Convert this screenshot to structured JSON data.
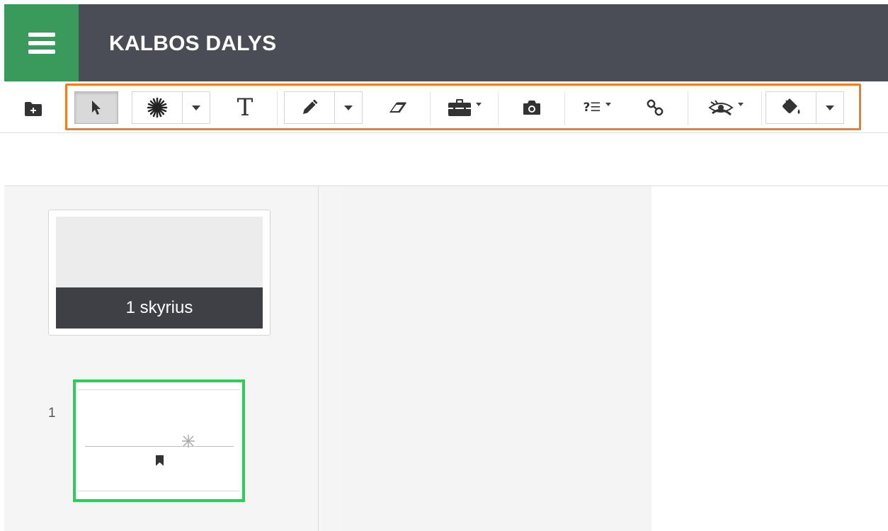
{
  "header": {
    "title": "KALBOS DALYS",
    "menu_icon": "hamburger-icon",
    "accent_color": "#3a9a5c",
    "bar_color": "#4a4d55"
  },
  "toolbar": {
    "folder_icon": "folder-add-icon",
    "highlight_color": "#f07c23",
    "tools": [
      {
        "name": "select",
        "icon": "cursor-arrow-icon",
        "active": true
      },
      {
        "name": "effects",
        "icon": "starburst-icon",
        "dropdown": true
      },
      {
        "name": "text",
        "icon": "text-icon",
        "glyph": "T"
      },
      {
        "name": "pen",
        "icon": "pencil-icon",
        "dropdown": true
      },
      {
        "name": "eraser",
        "icon": "eraser-icon"
      },
      {
        "name": "toolbox",
        "icon": "toolbox-icon",
        "dropdown": true
      },
      {
        "name": "camera",
        "icon": "camera-icon"
      },
      {
        "name": "quiz",
        "icon": "question-list-icon",
        "glyph": "?☰",
        "dropdown": true
      },
      {
        "name": "link",
        "icon": "link-icon"
      },
      {
        "name": "visibility",
        "icon": "eye-hide-icon",
        "dropdown": true
      },
      {
        "name": "fill",
        "icon": "paint-bucket-icon",
        "dropdown": true
      }
    ]
  },
  "sidebar": {
    "section_label": "1 skyrius",
    "page_number": "1",
    "selected_color": "#2ecc5a"
  }
}
